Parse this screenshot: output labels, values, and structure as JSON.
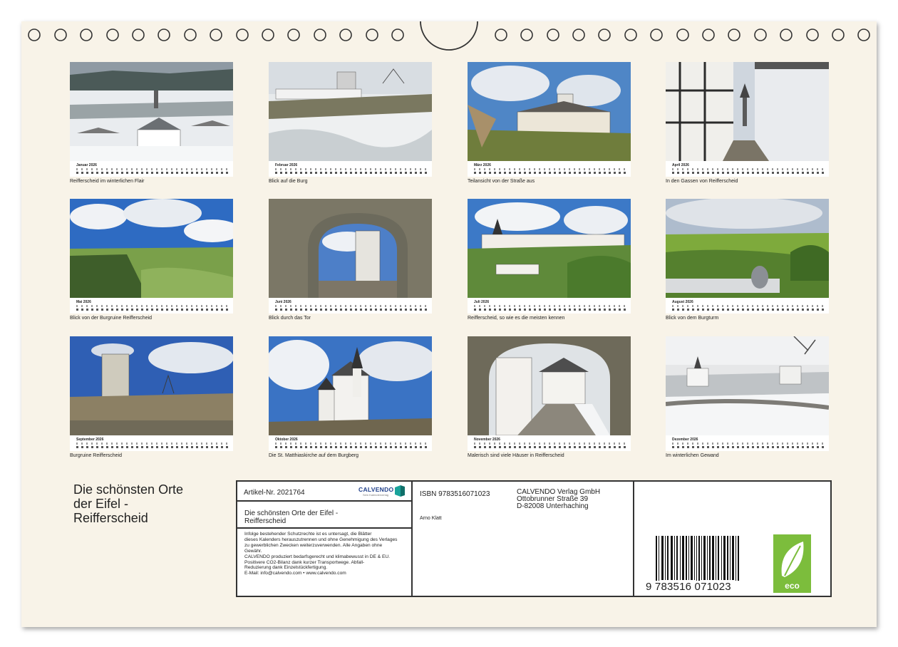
{
  "months": [
    {
      "month": "Januar 2026",
      "caption": "Reifferscheid im winterlichen Flair"
    },
    {
      "month": "Februar 2026",
      "caption": "Blick auf die Burg"
    },
    {
      "month": "März 2026",
      "caption": "Teilansicht von der Straße aus"
    },
    {
      "month": "April 2026",
      "caption": "In den Gassen von Reifferscheid"
    },
    {
      "month": "Mai 2026",
      "caption": "Blick von der Burgruine Reifferscheid"
    },
    {
      "month": "Juni 2026",
      "caption": "Blick durch das Tor"
    },
    {
      "month": "Juli 2026",
      "caption": "Reifferscheid, so wie es die meisten kennen"
    },
    {
      "month": "August 2026",
      "caption": "Blick von dem Burgturm"
    },
    {
      "month": "September 2026",
      "caption": "Burgruine Reifferscheid"
    },
    {
      "month": "Oktober 2026",
      "caption": "Die St. Matthiaskirche auf dem Burgberg"
    },
    {
      "month": "November 2026",
      "caption": "Malerisch sind viele Häuser in Reifferscheid"
    },
    {
      "month": "Dezember 2026",
      "caption": "Im winterlichen Gewand"
    }
  ],
  "cover": {
    "title_line1": "Die schönsten Orte",
    "title_line2": "der Eifel -",
    "title_line3": "Reifferscheid"
  },
  "info": {
    "article": "Artikel-Nr. 2021764",
    "logo_word": "CALVENDO",
    "logo_sub": "Sein Kalenderverlag",
    "title_line1": "Die schönsten Orte der Eifel -",
    "title_line2": "Reifferscheid",
    "legal": [
      "Infolge bestehender Schutzrechte ist es untersagt, die Blätter",
      "dieses Kalenders herauszutrennen und ohne Genehmigung des Verlages",
      "zu gewerblichen Zwecken weiterzuverwenden. Alle Angaben ohne",
      "Gewähr.",
      "CALVENDO produziert bedarfsgerecht und klimabewusst in DE & EU.",
      "Positivere CO2-Bilanz dank kurzer Transportwege. Abfall-",
      "Reduzierung dank Einzelstückfertigung.",
      "E-Mail: info@calvendo.com • www.calvendo.com"
    ],
    "isbn": "ISBN 9783516071023",
    "publisher_line1": "CALVENDO Verlag GmbH",
    "publisher_line2": "Ottobrunner Straße 39",
    "publisher_line3": "D-82008 Unterhaching",
    "author": "Arno Klatt",
    "barcode_digits": "9 783516 071023",
    "eco_label": "eco"
  },
  "colors": {
    "paper": "#f8f3e8",
    "border": "#333333",
    "eco_green": "#7cbd3c",
    "calvendo_blue": "#1f3f8a",
    "calvendo_teal": "#1aa39b"
  }
}
